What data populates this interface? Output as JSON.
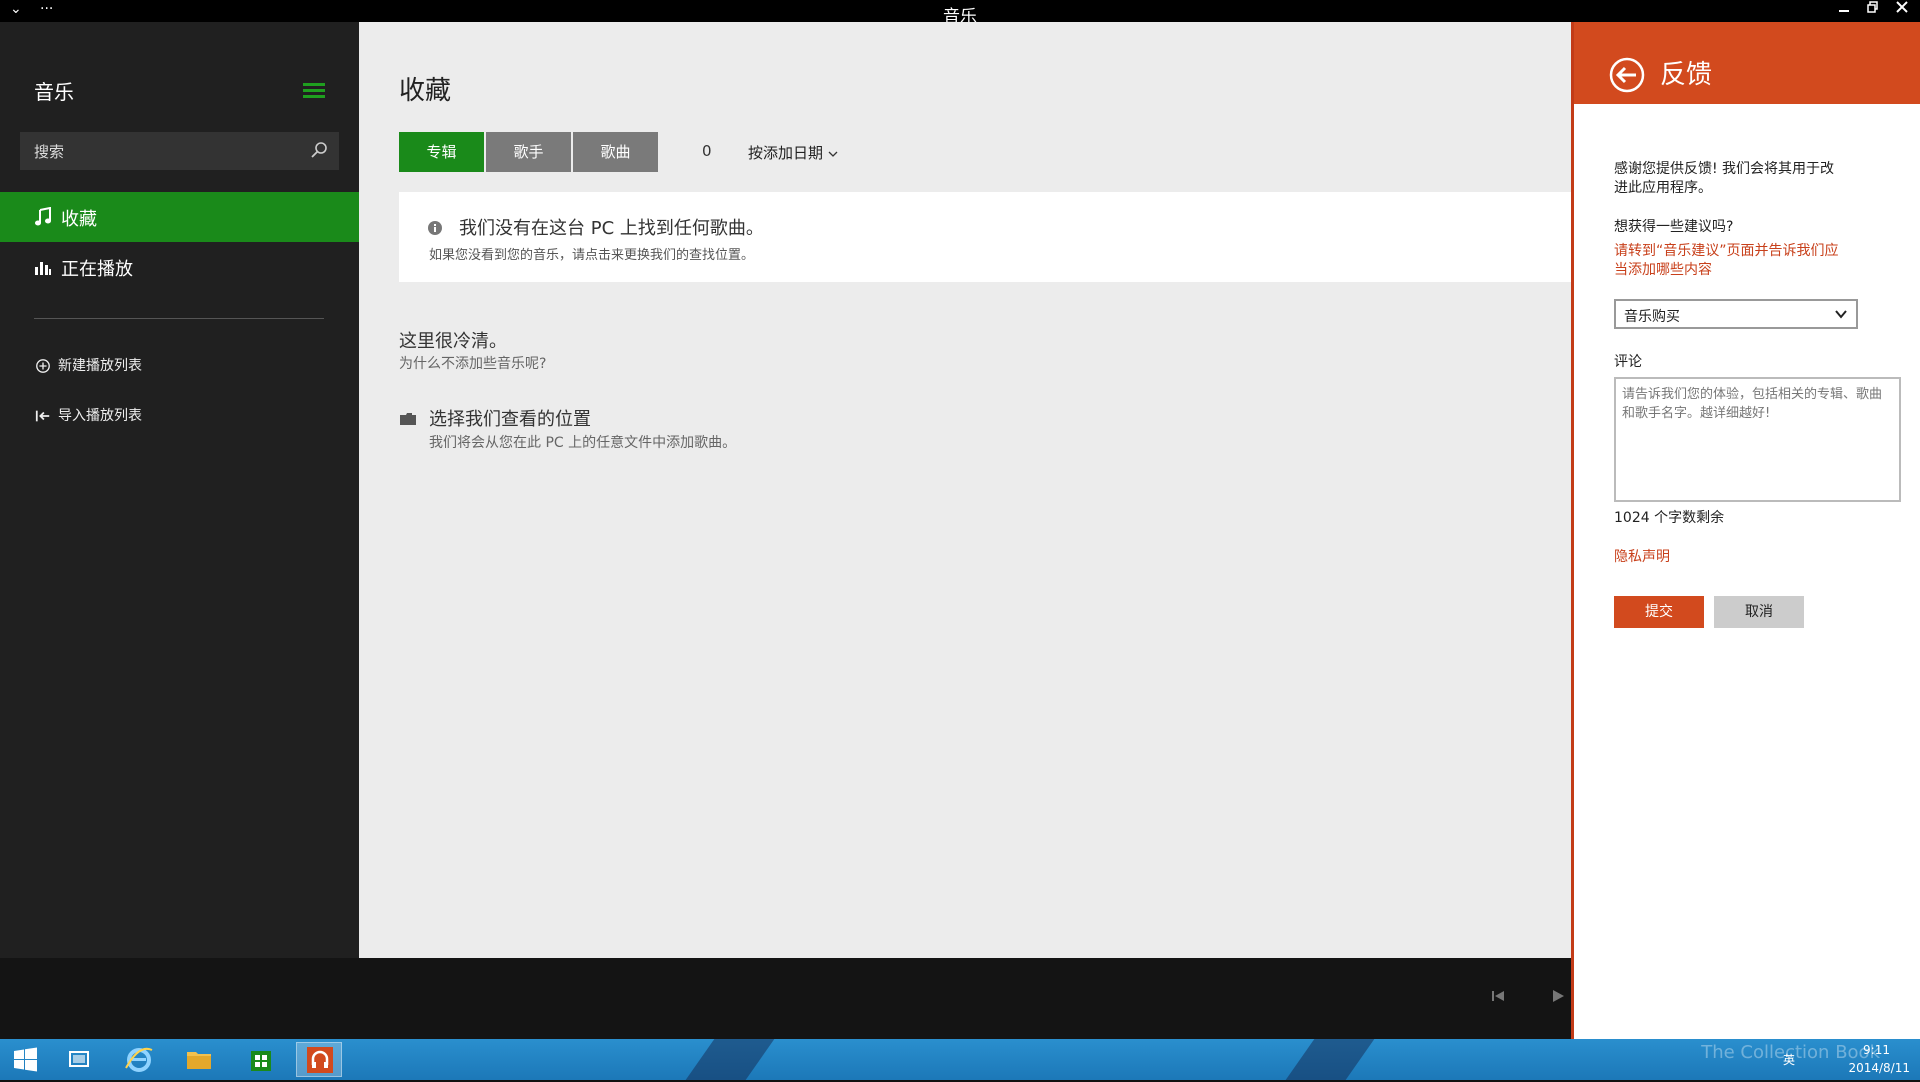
{
  "window": {
    "title": "音乐",
    "menu_glyph": "⌄",
    "more_glyph": "···"
  },
  "sidebar": {
    "app_name": "音乐",
    "search_placeholder": "搜索",
    "nav": [
      {
        "label": "收藏",
        "icon": "music-note-icon",
        "active": true
      },
      {
        "label": "正在播放",
        "icon": "equalizer-icon",
        "active": false
      }
    ],
    "actions": [
      {
        "label": "新建播放列表",
        "icon": "add-circle-icon"
      },
      {
        "label": "导入播放列表",
        "icon": "import-icon"
      }
    ]
  },
  "main": {
    "title": "收藏",
    "tabs": [
      {
        "label": "专辑",
        "active": true
      },
      {
        "label": "歌手",
        "active": false
      },
      {
        "label": "歌曲",
        "active": false
      }
    ],
    "count": "0",
    "sort_label": "按添加日期",
    "notice": {
      "title": "我们没有在这台 PC 上找到任何歌曲。",
      "detail": "如果您没看到您的音乐，请点击来更换我们的查找位置。"
    },
    "empty": {
      "heading": "这里很冷清。",
      "sub": "为什么不添加些音乐呢?"
    },
    "location": {
      "heading": "选择我们查看的位置",
      "sub": "我们将会从您在此 PC 上的任意文件中添加歌曲。"
    }
  },
  "feedback": {
    "title": "反馈",
    "thanks_line1": "感谢您提供反馈! 我们会将其用于改",
    "thanks_line2": "进此应用程序。",
    "suggest_question": "想获得一些建议吗?",
    "suggest_link_line1": "请转到“音乐建议”页面并告诉我们应",
    "suggest_link_line2": "当添加哪些内容",
    "category_value": "音乐购买",
    "comment_label": "评论",
    "comment_placeholder": "请告诉我们您的体验，包括相关的专辑、歌曲和歌手名字。越详细越好!",
    "chars_remaining": "1024 个字数剩余",
    "privacy_link": "隐私声明",
    "submit_label": "提交",
    "cancel_label": "取消"
  },
  "taskbar": {
    "ime": "英",
    "time": "9:11",
    "date": "2014/8/11",
    "watermark": "The Collection Book"
  },
  "colors": {
    "accent_green": "#1a8a1a",
    "accent_orange": "#d24a1e",
    "taskbar_blue": "#2a8fce"
  }
}
